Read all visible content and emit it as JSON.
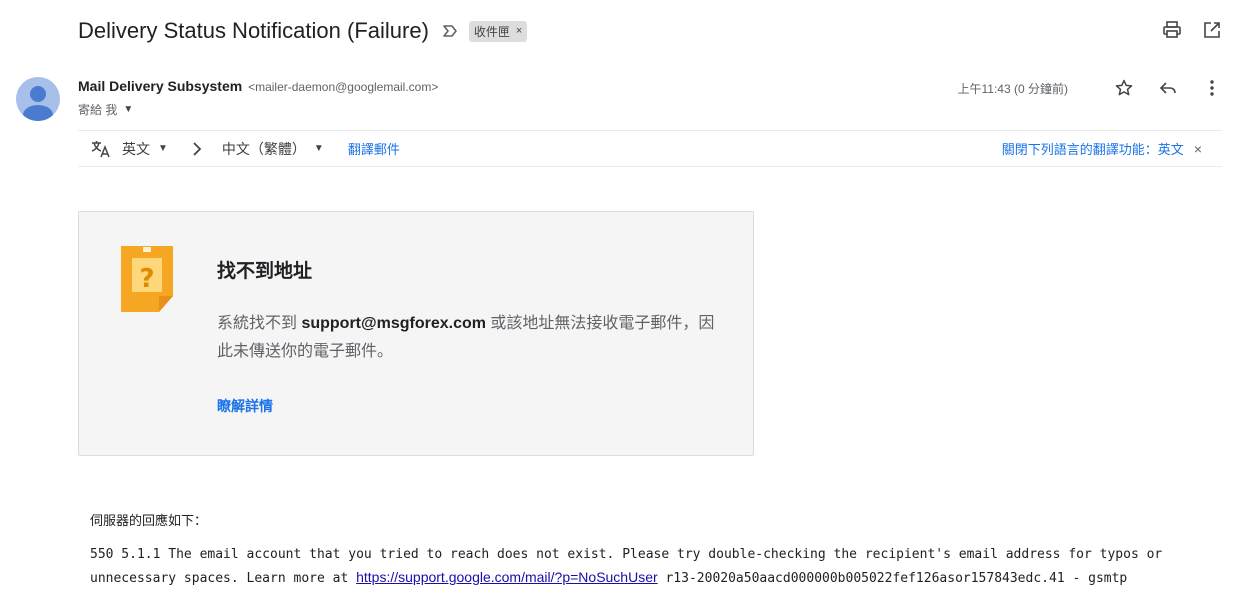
{
  "email": {
    "subject": "Delivery Status Notification (Failure)",
    "label_chip": "收件匣",
    "label_chip_close": "×"
  },
  "sender": {
    "name": "Mail Delivery Subsystem",
    "email": "<mailer-daemon@googlemail.com>",
    "to_text": "寄給 我",
    "time": "上午11:43 (0 分鐘前)"
  },
  "translate_bar": {
    "source_lang": "英文",
    "target_lang": "中文（繁體）",
    "translate_link": "翻譯郵件",
    "turn_off_text": "關閉下列語言的翻譯功能：英文",
    "close_symbol": "×"
  },
  "card": {
    "title": "找不到地址",
    "body_prefix": "系統找不到 ",
    "body_address": "support@msgforex.com",
    "body_suffix": " 或該地址無法接收電子郵件，因此未傳送你的電子郵件。",
    "learn_more": "瞭解詳情"
  },
  "server": {
    "label": "伺服器的回應如下：",
    "message_prefix": "550 5.1.1 The email account that you tried to reach does not exist. Please try double-checking the recipient's email address for typos or unnecessary spaces. Learn more at ",
    "link": "https://support.google.com/mail/?p=NoSuchUser",
    "message_suffix": " r13-20020a50aacd000000b005022fef126asor157843edc.41 - gsmtp"
  },
  "icons": {
    "important": "important-marker-icon",
    "print": "print-icon",
    "open_new_window": "open-in-new-window-icon",
    "star": "star-icon",
    "reply": "reply-icon",
    "more": "more-vertical-icon",
    "translate": "translate-icon",
    "arrow": "chevron-right-icon",
    "avatar": "default-avatar-icon",
    "warning": "question-note-icon"
  },
  "colors": {
    "link_blue": "#1a73e8",
    "warning_orange": "#f5a623",
    "avatar_bg": "#a6c0ea"
  }
}
